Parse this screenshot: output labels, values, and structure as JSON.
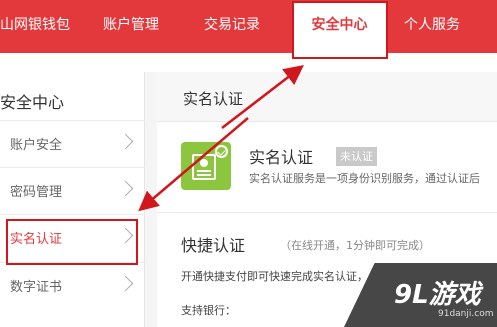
{
  "top_nav": {
    "items": [
      "山网银钱包",
      "账户管理",
      "交易记录",
      "安全中心",
      "个人服务"
    ],
    "active": "安全中心"
  },
  "sidebar": {
    "title": "安全中心",
    "items": [
      {
        "label": "账户安全"
      },
      {
        "label": "密码管理"
      },
      {
        "label": "实名认证"
      },
      {
        "label": "数字证书"
      }
    ],
    "active": "实名认证"
  },
  "main": {
    "title": "实名认证",
    "realname": {
      "title": "实名认证",
      "status": "未认证",
      "desc": "实名认证服务是一项身份识别服务，通过认证后"
    },
    "quick": {
      "title": "快捷认证",
      "sub": "（在线开通，1分钟即可完成）",
      "desc": "开通快捷支付即可快速完成实名认证，",
      "bank_label": "支持银行："
    }
  },
  "watermark": {
    "logo": "9L游戏",
    "url": "91danji.com"
  },
  "colors": {
    "brand_red": "#e4393c",
    "annotation_red": "#d0171d",
    "badge_green": "#8cc63f"
  }
}
